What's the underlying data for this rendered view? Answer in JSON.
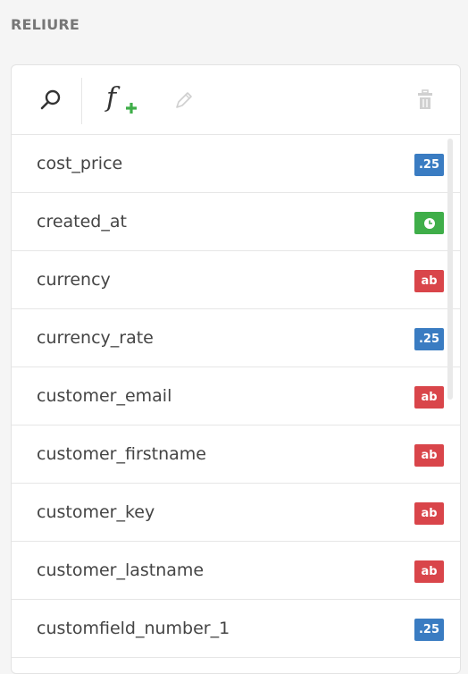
{
  "section": {
    "title": "RELIURE"
  },
  "toolbar": {
    "search_icon": "search-icon",
    "add_formula_icon": "function-add-icon",
    "edit_icon": "pencil-icon",
    "delete_icon": "trash-icon"
  },
  "colors": {
    "number_badge": "#3a7cc2",
    "date_badge": "#3fae49",
    "text_badge": "#d9454a"
  },
  "fields": [
    {
      "name": "cost_price",
      "type_label": ".25",
      "type": "number"
    },
    {
      "name": "created_at",
      "type_label": "",
      "type": "date"
    },
    {
      "name": "currency",
      "type_label": "ab",
      "type": "text"
    },
    {
      "name": "currency_rate",
      "type_label": ".25",
      "type": "number"
    },
    {
      "name": "customer_email",
      "type_label": "ab",
      "type": "text"
    },
    {
      "name": "customer_firstname",
      "type_label": "ab",
      "type": "text"
    },
    {
      "name": "customer_key",
      "type_label": "ab",
      "type": "text"
    },
    {
      "name": "customer_lastname",
      "type_label": "ab",
      "type": "text"
    },
    {
      "name": "customfield_number_1",
      "type_label": ".25",
      "type": "number"
    }
  ]
}
